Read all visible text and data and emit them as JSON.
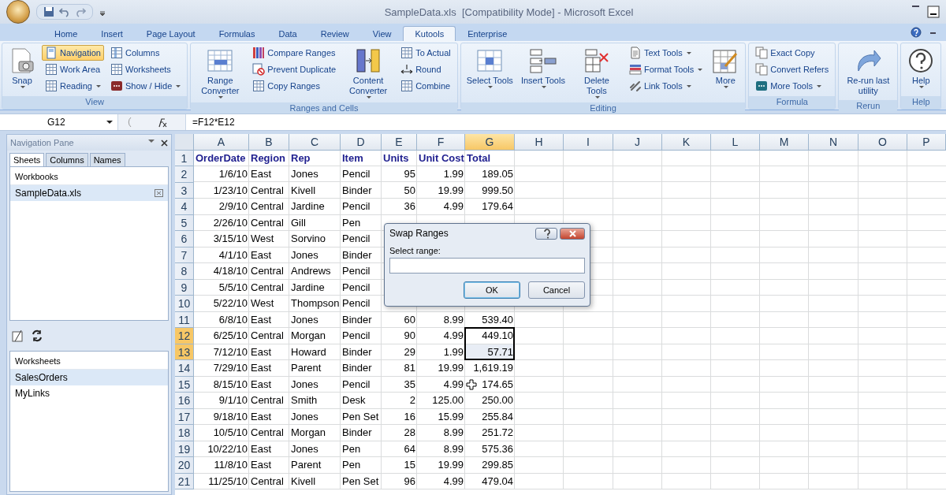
{
  "window": {
    "title": "SampleData.xls  [Compatibility Mode] - Microsoft Excel"
  },
  "ribbon_tabs": [
    {
      "label": "Home",
      "selected": false
    },
    {
      "label": "Insert",
      "selected": false
    },
    {
      "label": "Page Layout",
      "selected": false
    },
    {
      "label": "Formulas",
      "selected": false
    },
    {
      "label": "Data",
      "selected": false
    },
    {
      "label": "Review",
      "selected": false
    },
    {
      "label": "View",
      "selected": false
    },
    {
      "label": "Kutools",
      "selected": true
    },
    {
      "label": "Enterprise",
      "selected": false
    }
  ],
  "ribbon_groups": [
    {
      "label": "View",
      "columns": [
        {
          "kind": "large",
          "label": "Snap",
          "dropdown": true
        },
        {
          "kind": "stack",
          "items": [
            {
              "label": "Navigation",
              "dropdown": false,
              "selected": true
            },
            {
              "label": "Work Area",
              "dropdown": false,
              "selected": false
            },
            {
              "label": "Reading",
              "dropdown": true,
              "selected": false
            }
          ]
        },
        {
          "kind": "stack",
          "items": [
            {
              "label": "Columns",
              "dropdown": false,
              "selected": false
            },
            {
              "label": "Worksheets",
              "dropdown": false,
              "selected": false
            },
            {
              "label": "Show / Hide",
              "dropdown": true,
              "selected": false
            }
          ]
        }
      ]
    },
    {
      "label": "Ranges and Cells",
      "columns": [
        {
          "kind": "large",
          "label": "Range Converter",
          "dropdown": true
        },
        {
          "kind": "stack",
          "items": [
            {
              "label": "Compare Ranges",
              "dropdown": false,
              "selected": false
            },
            {
              "label": "Prevent Duplicate",
              "dropdown": false,
              "selected": false
            },
            {
              "label": "Copy Ranges",
              "dropdown": false,
              "selected": false
            }
          ]
        },
        {
          "kind": "large",
          "label": "Content Converter",
          "dropdown": true
        },
        {
          "kind": "stack",
          "items": [
            {
              "label": "To Actual",
              "dropdown": false,
              "selected": false
            },
            {
              "label": "Round",
              "dropdown": false,
              "selected": false
            },
            {
              "label": "Combine",
              "dropdown": false,
              "selected": false
            }
          ]
        }
      ]
    },
    {
      "label": "Editing",
      "columns": [
        {
          "kind": "large",
          "label": "Select Tools",
          "dropdown": true
        },
        {
          "kind": "large",
          "label": "Insert Tools",
          "dropdown": true
        },
        {
          "kind": "large",
          "label": "Delete Tools",
          "dropdown": true
        },
        {
          "kind": "stack",
          "items": [
            {
              "label": "Text Tools",
              "dropdown": true,
              "selected": false
            },
            {
              "label": "Format Tools",
              "dropdown": true,
              "selected": false
            },
            {
              "label": "Link Tools",
              "dropdown": true,
              "selected": false
            }
          ]
        },
        {
          "kind": "large",
          "label": "More",
          "dropdown": true
        }
      ]
    },
    {
      "label": "Formula",
      "columns": [
        {
          "kind": "stack",
          "items": [
            {
              "label": "Exact Copy",
              "dropdown": false,
              "selected": false
            },
            {
              "label": "Convert Refers",
              "dropdown": false,
              "selected": false
            },
            {
              "label": "More Tools",
              "dropdown": true,
              "selected": false
            }
          ]
        }
      ]
    },
    {
      "label": "Rerun",
      "columns": [
        {
          "kind": "large",
          "label": "Re-run last utility",
          "dropdown": false
        }
      ]
    },
    {
      "label": "Help",
      "columns": [
        {
          "kind": "large",
          "label": "Help",
          "dropdown": true
        }
      ]
    }
  ],
  "formula_bar": {
    "name_box": "G12",
    "formula": "=F12*E12"
  },
  "navigation_pane": {
    "title": "Navigation Pane",
    "tabs": [
      {
        "label": "Sheets",
        "selected": true
      },
      {
        "label": "Columns",
        "selected": false
      },
      {
        "label": "Names",
        "selected": false
      }
    ],
    "workbooks": {
      "header": "Workbooks",
      "items": [
        {
          "label": "SampleData.xls",
          "selected": true
        }
      ]
    },
    "worksheets": {
      "header": "Worksheets",
      "items": [
        {
          "label": "SalesOrders",
          "selected": true
        },
        {
          "label": "MyLinks",
          "selected": false
        }
      ]
    }
  },
  "sheet": {
    "columns": [
      {
        "label": "A",
        "selected": false
      },
      {
        "label": "B",
        "selected": false
      },
      {
        "label": "C",
        "selected": false
      },
      {
        "label": "D",
        "selected": false
      },
      {
        "label": "E",
        "selected": false
      },
      {
        "label": "F",
        "selected": false
      },
      {
        "label": "G",
        "selected": true
      },
      {
        "label": "H",
        "selected": false
      },
      {
        "label": "I",
        "selected": false
      },
      {
        "label": "J",
        "selected": false
      },
      {
        "label": "K",
        "selected": false
      },
      {
        "label": "L",
        "selected": false
      },
      {
        "label": "M",
        "selected": false
      },
      {
        "label": "N",
        "selected": false
      },
      {
        "label": "O",
        "selected": false
      },
      {
        "label": "P",
        "selected": false
      }
    ],
    "rows": [
      {
        "number": "1",
        "kind": "header",
        "selected": false,
        "cells": [
          "OrderDate",
          "Region",
          "Rep",
          "Item",
          "Units",
          "Unit Cost",
          "Total"
        ]
      },
      {
        "number": "2",
        "kind": "data",
        "selected": false,
        "cells": [
          "1/6/10",
          "East",
          "Jones",
          "Pencil",
          "95",
          "1.99",
          "189.05"
        ]
      },
      {
        "number": "3",
        "kind": "data",
        "selected": false,
        "cells": [
          "1/23/10",
          "Central",
          "Kivell",
          "Binder",
          "50",
          "19.99",
          "999.50"
        ]
      },
      {
        "number": "4",
        "kind": "data",
        "selected": false,
        "cells": [
          "2/9/10",
          "Central",
          "Jardine",
          "Pencil",
          "36",
          "4.99",
          "179.64"
        ]
      },
      {
        "number": "5",
        "kind": "data",
        "selected": false,
        "cells": [
          "2/26/10",
          "Central",
          "Gill",
          "Pen"
        ]
      },
      {
        "number": "6",
        "kind": "data",
        "selected": false,
        "cells": [
          "3/15/10",
          "West",
          "Sorvino",
          "Pencil"
        ]
      },
      {
        "number": "7",
        "kind": "data",
        "selected": false,
        "cells": [
          "4/1/10",
          "East",
          "Jones",
          "Binder"
        ]
      },
      {
        "number": "8",
        "kind": "data",
        "selected": false,
        "cells": [
          "4/18/10",
          "Central",
          "Andrews",
          "Pencil"
        ]
      },
      {
        "number": "9",
        "kind": "data",
        "selected": false,
        "cells": [
          "5/5/10",
          "Central",
          "Jardine",
          "Pencil"
        ]
      },
      {
        "number": "10",
        "kind": "data",
        "selected": false,
        "cells": [
          "5/22/10",
          "West",
          "Thompson",
          "Pencil"
        ]
      },
      {
        "number": "11",
        "kind": "data",
        "selected": false,
        "cells": [
          "6/8/10",
          "East",
          "Jones",
          "Binder",
          "60",
          "8.99",
          "539.40"
        ]
      },
      {
        "number": "12",
        "kind": "data",
        "selected": true,
        "cells": [
          "6/25/10",
          "Central",
          "Morgan",
          "Pencil",
          "90",
          "4.99",
          "449.10"
        ]
      },
      {
        "number": "13",
        "kind": "data",
        "selected": true,
        "cells": [
          "7/12/10",
          "East",
          "Howard",
          "Binder",
          "29",
          "1.99",
          "57.71"
        ]
      },
      {
        "number": "14",
        "kind": "data",
        "selected": false,
        "cells": [
          "7/29/10",
          "East",
          "Parent",
          "Binder",
          "81",
          "19.99",
          "1,619.19"
        ]
      },
      {
        "number": "15",
        "kind": "data",
        "selected": false,
        "cells": [
          "8/15/10",
          "East",
          "Jones",
          "Pencil",
          "35",
          "4.99",
          "174.65"
        ]
      },
      {
        "number": "16",
        "kind": "data",
        "selected": false,
        "cells": [
          "9/1/10",
          "Central",
          "Smith",
          "Desk",
          "2",
          "125.00",
          "250.00"
        ]
      },
      {
        "number": "17",
        "kind": "data",
        "selected": false,
        "cells": [
          "9/18/10",
          "East",
          "Jones",
          "Pen Set",
          "16",
          "15.99",
          "255.84"
        ]
      },
      {
        "number": "18",
        "kind": "data",
        "selected": false,
        "cells": [
          "10/5/10",
          "Central",
          "Morgan",
          "Binder",
          "28",
          "8.99",
          "251.72"
        ]
      },
      {
        "number": "19",
        "kind": "data",
        "selected": false,
        "cells": [
          "10/22/10",
          "East",
          "Jones",
          "Pen",
          "64",
          "8.99",
          "575.36"
        ]
      },
      {
        "number": "20",
        "kind": "data",
        "selected": false,
        "cells": [
          "11/8/10",
          "East",
          "Parent",
          "Pen",
          "15",
          "19.99",
          "299.85"
        ]
      },
      {
        "number": "21",
        "kind": "data",
        "selected": false,
        "cells": [
          "11/25/10",
          "Central",
          "Kivell",
          "Pen Set",
          "96",
          "4.99",
          "479.04"
        ]
      }
    ]
  },
  "dialog": {
    "title": "Swap Ranges",
    "field_label": "Select range:",
    "buttons": [
      {
        "label": "OK",
        "default": true
      },
      {
        "label": "Cancel",
        "default": false
      }
    ]
  }
}
